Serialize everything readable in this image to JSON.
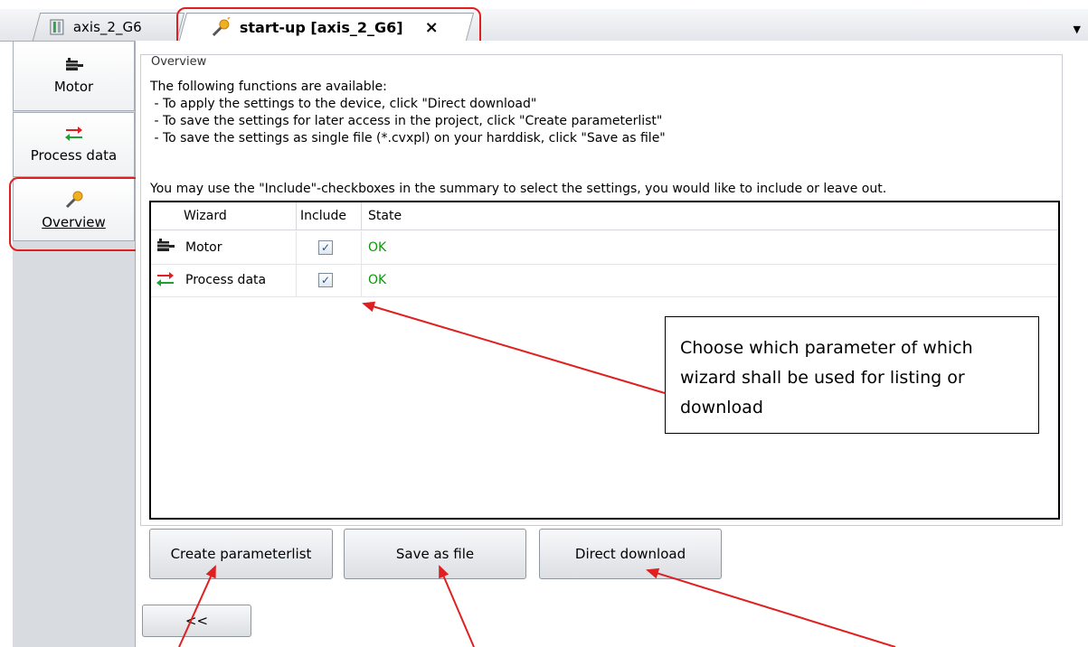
{
  "tabs": [
    {
      "label": "axis_2_G6"
    },
    {
      "label": "start-up [axis_2_G6]",
      "close": "×"
    }
  ],
  "nav": {
    "items": [
      {
        "label": "Motor"
      },
      {
        "label": "Process data"
      },
      {
        "label": "Overview"
      }
    ]
  },
  "overview": {
    "title": "Overview",
    "lines": [
      "The following functions are available:",
      " - To apply the settings to the device, click \"Direct download\"",
      " - To save the settings for later access in the project, click \"Create parameterlist\"",
      " - To save the settings as single file (*.cvxpl) on your harddisk, click \"Save as file\""
    ],
    "hint": "You may use the \"Include\"-checkboxes in the summary to select the settings, you would like to include or leave out."
  },
  "grid": {
    "headers": [
      "Wizard",
      "Include",
      "State"
    ],
    "rows": [
      {
        "wizard": "Motor",
        "include": "✓",
        "state": "OK"
      },
      {
        "wizard": "Process data",
        "include": "✓",
        "state": "OK"
      }
    ]
  },
  "callout": {
    "text": "Choose which parameter of which wizard shall be used for listing or download"
  },
  "buttons": {
    "create": "Create parameterlist",
    "save": "Save as file",
    "download": "Direct download",
    "back": "<<"
  },
  "colors": {
    "highlight": "#e02020",
    "ok": "#0a9a0a"
  }
}
